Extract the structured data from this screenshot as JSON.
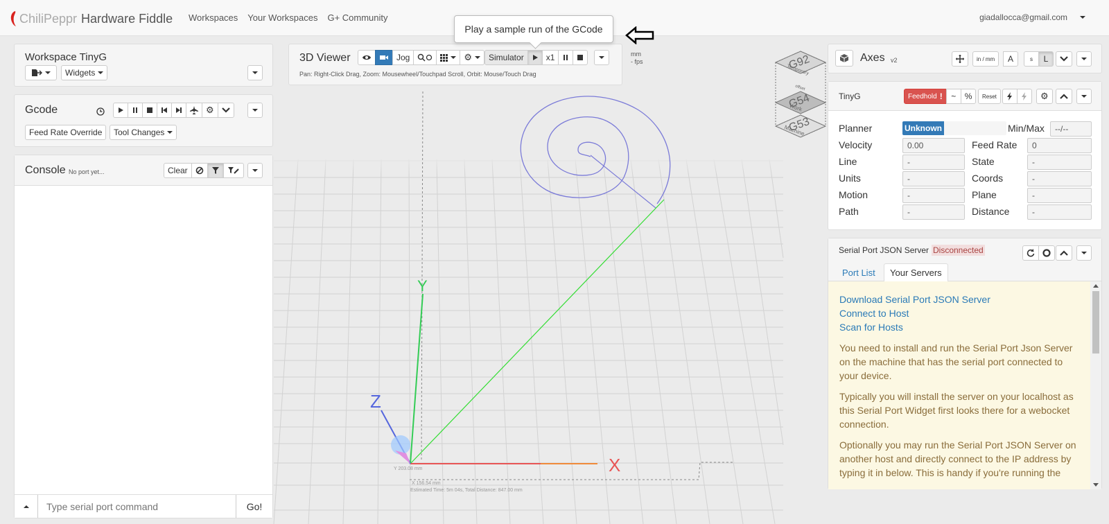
{
  "nav": {
    "brand_chili": "ChiliPeppr",
    "brand_rest": "Hardware Fiddle",
    "links": [
      "Workspaces",
      "Your Workspaces",
      "G+ Community"
    ],
    "user_email": "giadallocca@gmail.com"
  },
  "workspace": {
    "title": "Workspace TinyG",
    "widgets_label": "Widgets"
  },
  "gcode": {
    "title": "Gcode",
    "feed_rate_override": "Feed Rate Override",
    "tool_changes": "Tool Changes"
  },
  "console": {
    "title": "Console",
    "port_status": "No port yet...",
    "clear_label": "Clear",
    "input_placeholder": "Type serial port command",
    "go_label": "Go!"
  },
  "viewer": {
    "title": "3D Viewer",
    "jog_label": "Jog",
    "simulator_label": "Simulator",
    "speed_label": "x1",
    "help_text": "Pan: Right-Click Drag, Zoom: Mousewheel/Touchpad Scroll, Orbit: Mouse/Touch Drag",
    "units": "mm",
    "fps": "- fps",
    "tooltip": "Play a sample run of the GCode",
    "axis_x": "X",
    "axis_y": "Y",
    "axis_z": "Z",
    "y_dim": "Y 203.08 mm",
    "x_dim": "X 156.54 mm",
    "estimate": "Estimated Time: 5m 04s, Total Distance: 847.00 mm"
  },
  "cube": {
    "g92": "G92",
    "g92_label": "Temporary",
    "g54": "G54",
    "g54_label": "Work",
    "g53": "G53",
    "g53_label": "Machine",
    "mid_label": "offset"
  },
  "axes": {
    "title": "Axes",
    "version": "v2",
    "in_mm": "in / mm",
    "a_label": "A",
    "s_label": "s",
    "l_label": "L"
  },
  "tinyg": {
    "title": "TinyG",
    "feedhold": "Feedhold",
    "tilde": "~",
    "percent": "%",
    "reset": "Reset",
    "planner_label": "Planner",
    "planner_value": "Unknown",
    "planner_fraction": 0.4,
    "minmax_label": "Min/Max",
    "minmax_value": "--/--",
    "rows": [
      {
        "label": "Velocity",
        "value": "0.00",
        "label2": "Feed Rate",
        "value2": "0"
      },
      {
        "label": "Line",
        "value": "-",
        "label2": "State",
        "value2": "-"
      },
      {
        "label": "Units",
        "value": "-",
        "label2": "Coords",
        "value2": "-"
      },
      {
        "label": "Motion",
        "value": "-",
        "label2": "Plane",
        "value2": "-"
      },
      {
        "label": "Path",
        "value": "-",
        "label2": "Distance",
        "value2": "-"
      }
    ]
  },
  "serial": {
    "title": "Serial Port JSON Server",
    "status": "Disconnected",
    "tabs": [
      "Port List",
      "Your Servers"
    ],
    "links": [
      "Download Serial Port JSON Server",
      "Connect to Host",
      "Scan for Hosts"
    ],
    "paragraphs": [
      "You need to install and run the Serial Port Json Server on the machine that has the serial port connected to your device.",
      "Typically you will install the server on your localhost as this Serial Port Widget first looks there for a webocket connection.",
      "Optionally you may run the Serial Port JSON Server on another host and directly connect to the IP address by typing it in below. This is handy if you're running the"
    ]
  },
  "colors": {
    "accent": "#337ab7",
    "feedhold": "#d9534f",
    "disconnected_bg": "#f2dede",
    "serial_body_bg": "#fcf8e3",
    "spiral": "#7b7bd8",
    "path": "#33dd33",
    "axis_x": "#e85555",
    "axis_y": "#33cc55",
    "axis_z": "#5566dd"
  }
}
